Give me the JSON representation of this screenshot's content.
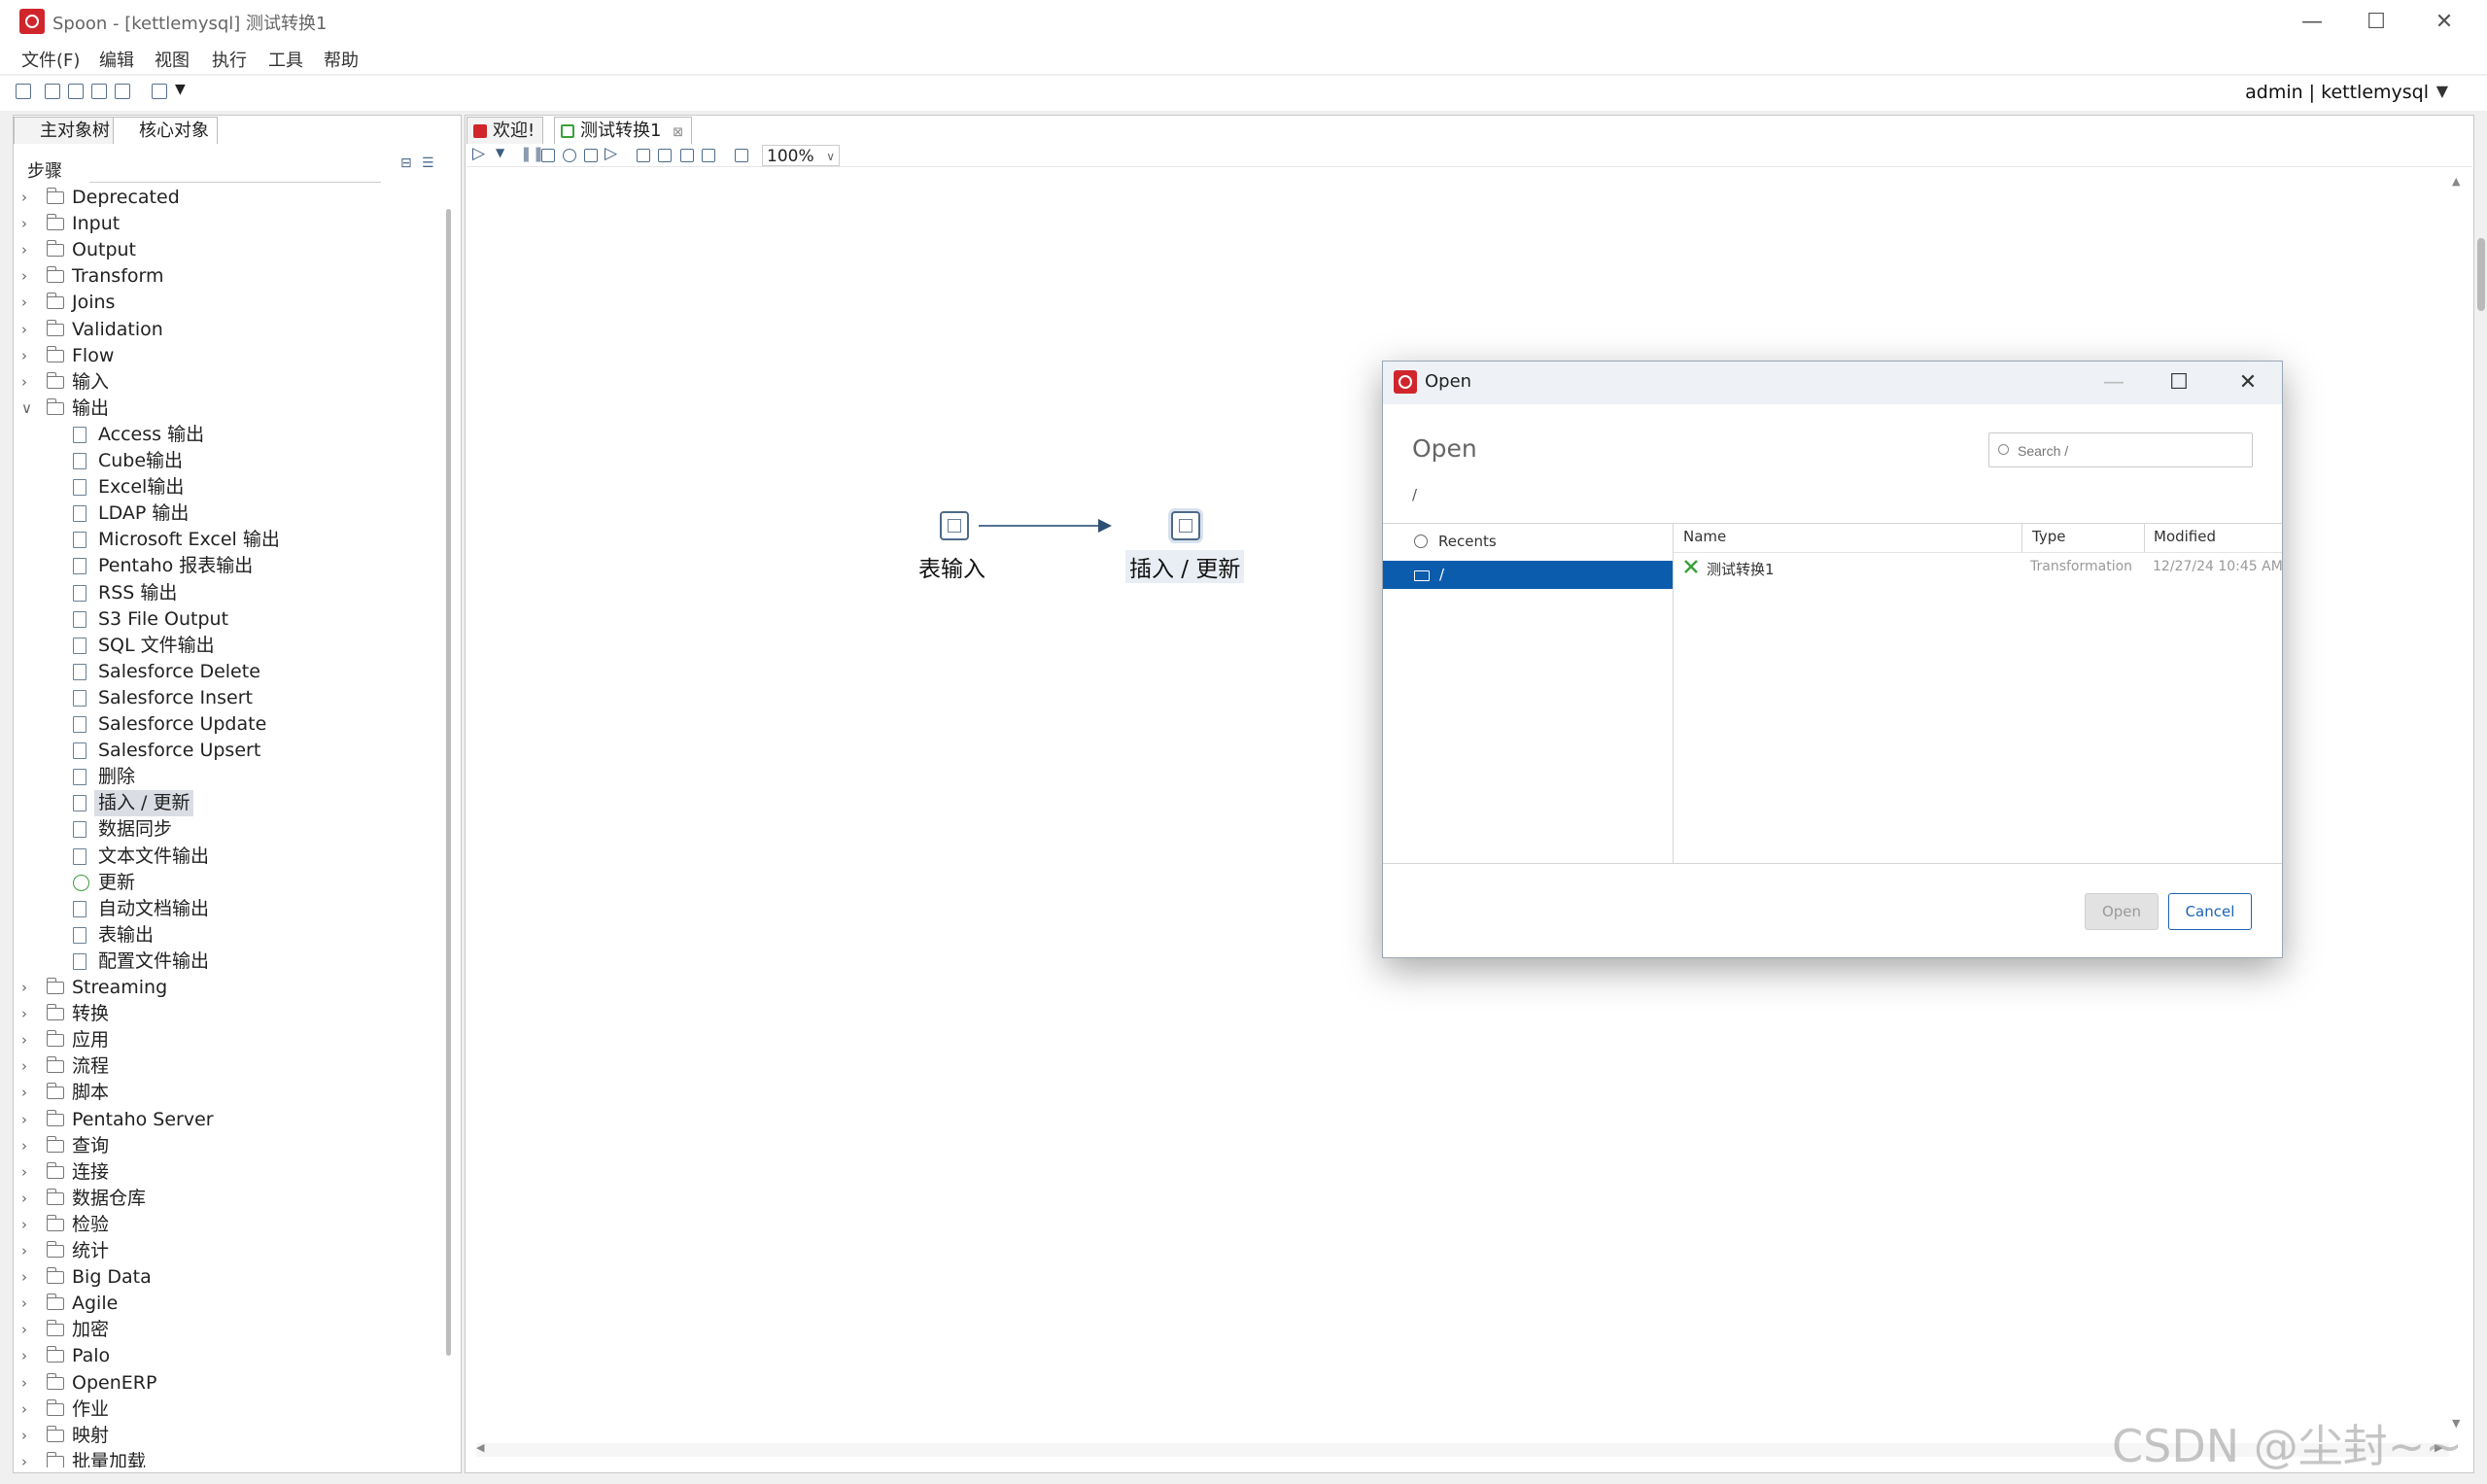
{
  "window": {
    "title": "Spoon - [kettlemysql] 测试转换1",
    "minimize": "—",
    "maximize": "☐",
    "close": "✕"
  },
  "menu": [
    "文件(F)",
    "编辑",
    "视图",
    "执行",
    "工具",
    "帮助"
  ],
  "toolbar": {
    "user": "admin  |  kettlemysql",
    "caret": "▼"
  },
  "left_panel": {
    "tabs": [
      "主对象树",
      "核心对象"
    ],
    "steps_label": "步骤",
    "search_placeholder": "",
    "tree": [
      {
        "label": "Deprecated",
        "expanded": false
      },
      {
        "label": "Input",
        "expanded": false
      },
      {
        "label": "Output",
        "expanded": false
      },
      {
        "label": "Transform",
        "expanded": false
      },
      {
        "label": "Joins",
        "expanded": false
      },
      {
        "label": "Validation",
        "expanded": false
      },
      {
        "label": "Flow",
        "expanded": false
      },
      {
        "label": "输入",
        "expanded": false
      },
      {
        "label": "输出",
        "expanded": true
      }
    ],
    "output_children": [
      "Access 输出",
      "Cube输出",
      "Excel输出",
      "LDAP 输出",
      "Microsoft Excel 输出",
      "Pentaho 报表输出",
      "RSS 输出",
      "S3 File Output",
      "SQL 文件输出",
      "Salesforce Delete",
      "Salesforce Insert",
      "Salesforce Update",
      "Salesforce Upsert",
      "删除",
      "插入 / 更新",
      "数据同步",
      "文本文件输出",
      "更新",
      "自动文档输出",
      "表输出",
      "配置文件输出"
    ],
    "selected_child": "插入 / 更新",
    "tree_after": [
      "Streaming",
      "转换",
      "应用",
      "流程",
      "脚本",
      "Pentaho Server",
      "查询",
      "连接",
      "数据仓库",
      "检验",
      "统计",
      "Big Data",
      "Agile",
      "加密",
      "Palo",
      "OpenERP",
      "作业",
      "映射",
      "批量加载"
    ]
  },
  "editor": {
    "tabs": [
      "欢迎!",
      "测试转换1"
    ],
    "tab_close": "⊠",
    "zoom": "100%",
    "nodes": {
      "source": "表输入",
      "target": "插入 / 更新"
    }
  },
  "dialog": {
    "title": "Open",
    "heading": "Open",
    "search_placeholder": "Search /",
    "path": "/",
    "recents": "Recents",
    "root": "/",
    "columns": [
      "Name",
      "Type",
      "Modified"
    ],
    "files": [
      {
        "name": "测试转换1",
        "type": "Transformation",
        "modified": "12/27/24 10:45 AM"
      }
    ],
    "open_button": "Open",
    "cancel_button": "Cancel",
    "minimize": "—",
    "maximize": "☐",
    "close": "✕"
  },
  "watermark": "CSDN @尘封~~",
  "colors": {
    "brand": "#d0262b",
    "selection": "#0b5cad",
    "cancel": "#1d63b3"
  }
}
